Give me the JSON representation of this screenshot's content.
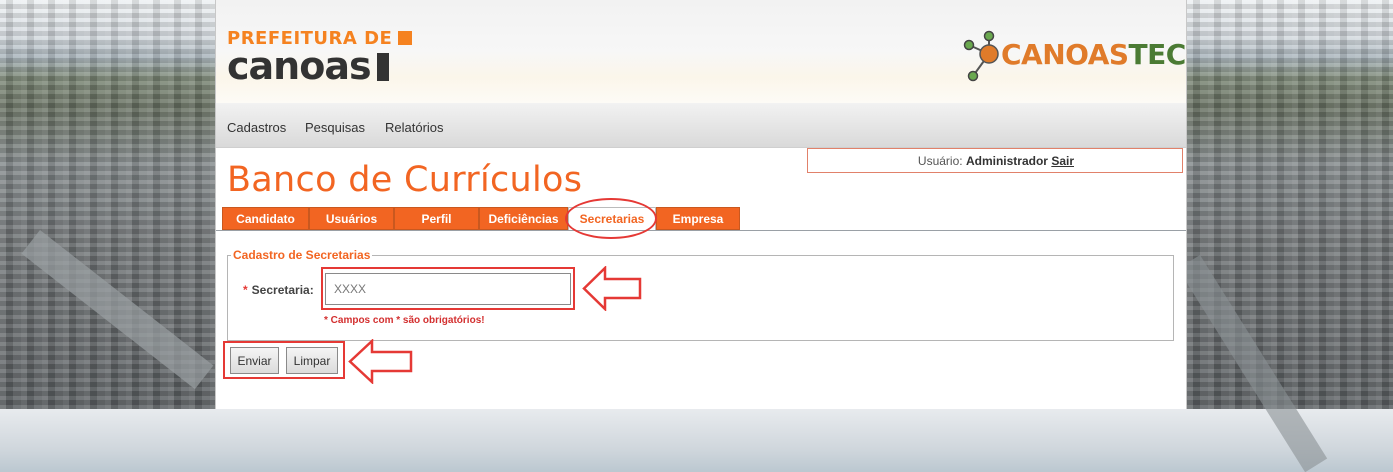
{
  "logos": {
    "prefeitura_line1": "PREFEITURA DE",
    "prefeitura_line2": "canoas",
    "canoastec_part1": "CANOAS",
    "canoastec_part2": "TEC"
  },
  "menu": {
    "items": [
      {
        "label": "Cadastros"
      },
      {
        "label": "Pesquisas"
      },
      {
        "label": "Relatórios"
      }
    ]
  },
  "page_title": "Banco de Currículos",
  "user": {
    "prefix": "Usuário:",
    "name": "Administrador",
    "logout_label": "Sair"
  },
  "tabs": [
    {
      "label": "Candidato",
      "active": false
    },
    {
      "label": "Usuários",
      "active": false
    },
    {
      "label": "Perfil",
      "active": false
    },
    {
      "label": "Deficiências",
      "active": false
    },
    {
      "label": "Secretarias",
      "active": true
    },
    {
      "label": "Empresa",
      "active": false
    }
  ],
  "form": {
    "legend": "Cadastro de Secretarias",
    "required_mark": "*",
    "field_label": "Secretaria:",
    "field_value": "XXXX",
    "required_note": "* Campos com * são obrigatórios!",
    "submit_label": "Enviar",
    "reset_label": "Limpar"
  },
  "colors": {
    "accent": "#f26522",
    "annotation": "#e53935",
    "canoastec_green": "#4b7b34"
  },
  "icons": {
    "logo_molecule": "molecule-icon",
    "annotation_arrow": "left-arrow-icon"
  }
}
